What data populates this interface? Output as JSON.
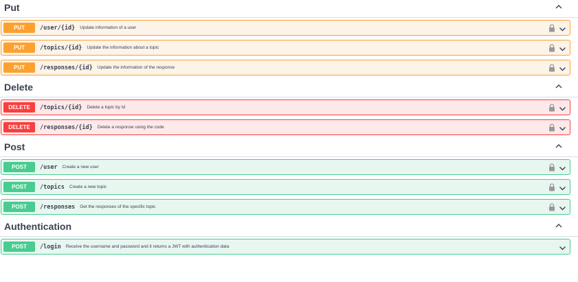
{
  "sections": [
    {
      "title": "Put",
      "operations": [
        {
          "method": "PUT",
          "path": "/user/{id}",
          "summary": "Update information of a user",
          "locked": true
        },
        {
          "method": "PUT",
          "path": "/topics/{id}",
          "summary": "Update the information about a topic",
          "locked": true
        },
        {
          "method": "PUT",
          "path": "/responses/{id}",
          "summary": "Update the information of the response",
          "locked": true
        }
      ]
    },
    {
      "title": "Delete",
      "operations": [
        {
          "method": "DELETE",
          "path": "/topics/{id}",
          "summary": "Delete a topic by Id",
          "locked": true
        },
        {
          "method": "DELETE",
          "path": "/responses/{id}",
          "summary": "Delete a response using the code",
          "locked": true
        }
      ]
    },
    {
      "title": "Post",
      "operations": [
        {
          "method": "POST",
          "path": "/user",
          "summary": "Create a new user",
          "locked": true
        },
        {
          "method": "POST",
          "path": "/topics",
          "summary": "Create a new topic",
          "locked": true
        },
        {
          "method": "POST",
          "path": "/responses",
          "summary": "Get the responses of the specific topic",
          "locked": true
        }
      ]
    },
    {
      "title": "Authentication",
      "operations": [
        {
          "method": "POST",
          "path": "/login",
          "summary": "Receive the username and password and it returns a JWT with authentication data",
          "locked": false
        }
      ]
    }
  ],
  "icons": {
    "section_toggle": "chevron-up-icon",
    "lock": "lock-icon",
    "expand": "chevron-down-icon"
  },
  "colors": {
    "put": "#fca130",
    "delete": "#f93e3e",
    "post": "#49cc90"
  }
}
